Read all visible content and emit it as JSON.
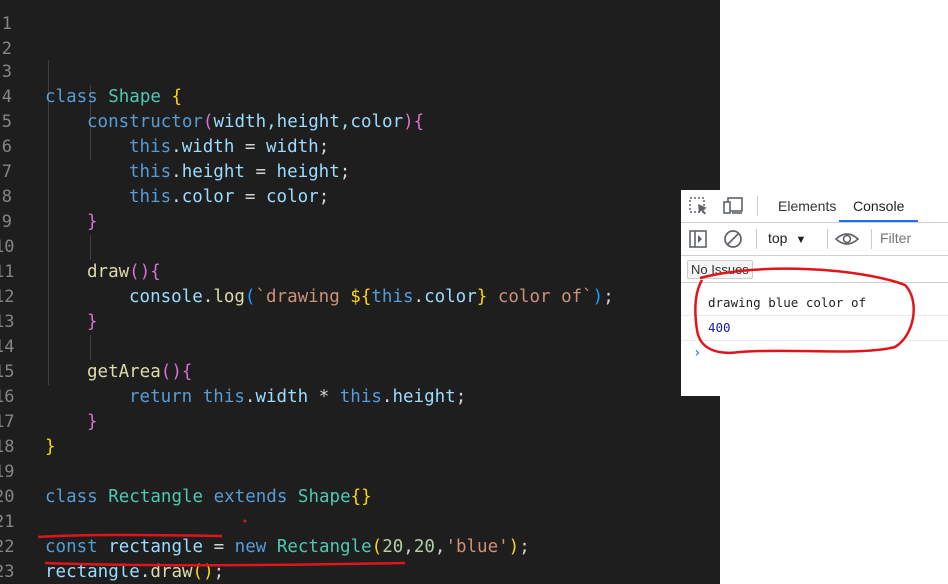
{
  "editor": {
    "line_numbers": [
      "1",
      "2",
      "3",
      "4",
      "5",
      "6",
      "7",
      "8",
      "9",
      "10",
      "11",
      "12",
      "13",
      "14",
      "15",
      "16",
      "17",
      "18",
      "19",
      "20",
      "21",
      "22",
      "23"
    ],
    "tokens": {
      "class_kw": "class",
      "shape": "Shape",
      "brace_open": "{",
      "brace_close": "}",
      "constructor": "constructor",
      "paren_open": "(",
      "paren_close": ")",
      "params": "width,height,color",
      "this": "this",
      "width": "width",
      "height": "height",
      "color": "color",
      "dot": ".",
      "assign": " = ",
      "semicolon": ";",
      "draw": "draw",
      "console": "console",
      "log": "log",
      "template_start": "`drawing ",
      "interp_open": "${",
      "interp_close": "}",
      "template_end": " color of`",
      "getArea": "getArea",
      "return_kw": "return",
      "mult": " * ",
      "rectangle_class": "Rectangle",
      "extends_kw": "extends",
      "empty_braces_open": "{",
      "empty_braces_close": "}",
      "const_kw": "const",
      "rectangle_var": "rectangle",
      "new_kw": "new",
      "num20": "20",
      "comma": ",",
      "blue_str": "'blue'",
      "space": " "
    }
  },
  "devtools": {
    "tabs": [
      "Elements",
      "Console"
    ],
    "context": "top",
    "filter_placeholder": "Filter",
    "issues_label": "No Issues",
    "console_output": [
      "drawing blue color of",
      "400"
    ],
    "prompt_glyph": "›",
    "colors": {
      "number_output": "#1a1aa6",
      "active_tab": "#1a73e8"
    }
  },
  "colors": {
    "annotation": "#e0151b",
    "editor_bg": "#1e1e1e"
  }
}
